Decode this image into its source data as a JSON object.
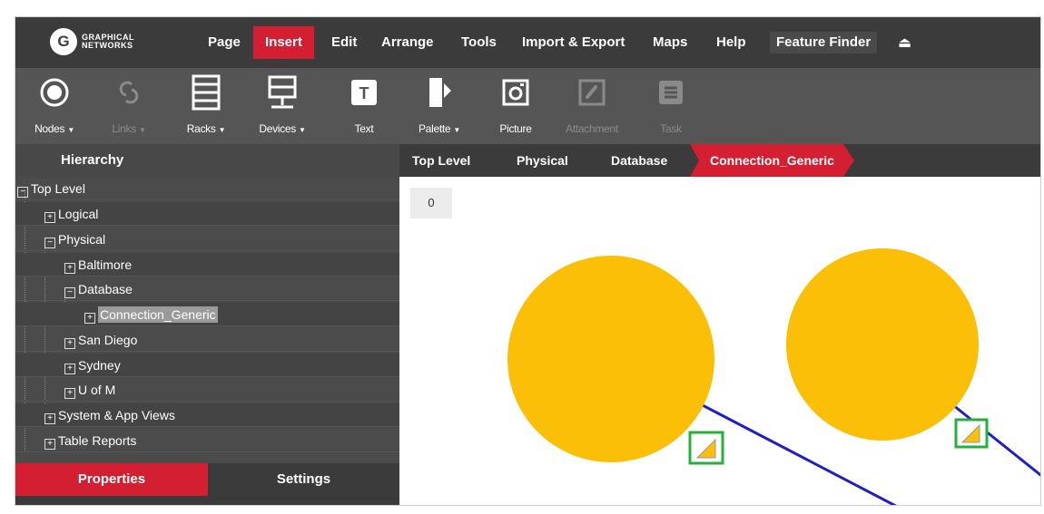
{
  "app": {
    "logo_letter": "G",
    "logo_line1": "GRAPHICAL",
    "logo_line2": "NETWORKS"
  },
  "menu": {
    "items": [
      "Page",
      "Insert",
      "Edit",
      "Arrange",
      "Tools",
      "Import & Export",
      "Maps",
      "Help"
    ],
    "active": "Insert",
    "feature_finder": "Feature Finder"
  },
  "toolbar": {
    "tools": [
      {
        "label": "Nodes",
        "icon": "nodes-icon",
        "dropdown": true,
        "enabled": true
      },
      {
        "label": "Links",
        "icon": "links-icon",
        "dropdown": true,
        "enabled": false
      },
      {
        "label": "Racks",
        "icon": "racks-icon",
        "dropdown": true,
        "enabled": true
      },
      {
        "label": "Devices",
        "icon": "devices-icon",
        "dropdown": true,
        "enabled": true
      },
      {
        "label": "Text",
        "icon": "text-icon",
        "dropdown": false,
        "enabled": true
      },
      {
        "label": "Palette",
        "icon": "palette-icon",
        "dropdown": true,
        "enabled": true
      },
      {
        "label": "Picture",
        "icon": "picture-icon",
        "dropdown": false,
        "enabled": true
      },
      {
        "label": "Attachment",
        "icon": "attachment-icon",
        "dropdown": false,
        "enabled": false
      },
      {
        "label": "Task",
        "icon": "task-icon",
        "dropdown": false,
        "enabled": false
      }
    ]
  },
  "sidebar": {
    "header": "Hierarchy",
    "tree": [
      {
        "label": "Top Level",
        "toggle": "−"
      },
      {
        "label": "Logical",
        "toggle": "+"
      },
      {
        "label": "Physical",
        "toggle": "−"
      },
      {
        "label": "Baltimore",
        "toggle": "+"
      },
      {
        "label": "Database",
        "toggle": "−"
      },
      {
        "label": "Connection_Generic",
        "toggle": "+"
      },
      {
        "label": "San Diego",
        "toggle": "+"
      },
      {
        "label": "Sydney",
        "toggle": "+"
      },
      {
        "label": "U of M",
        "toggle": "+"
      },
      {
        "label": "System & App Views",
        "toggle": "+"
      },
      {
        "label": "Table Reports",
        "toggle": "+"
      }
    ],
    "tabs": {
      "properties": "Properties",
      "settings": "Settings"
    }
  },
  "breadcrumb": [
    "Top Level",
    "Physical",
    "Database",
    "Connection_Generic"
  ],
  "canvas": {
    "zoom_value": "0"
  },
  "colors": {
    "accent": "#d31f31",
    "node_fill": "#fbbf08",
    "link": "#1f1fc4",
    "handle_border": "#22b23a"
  }
}
